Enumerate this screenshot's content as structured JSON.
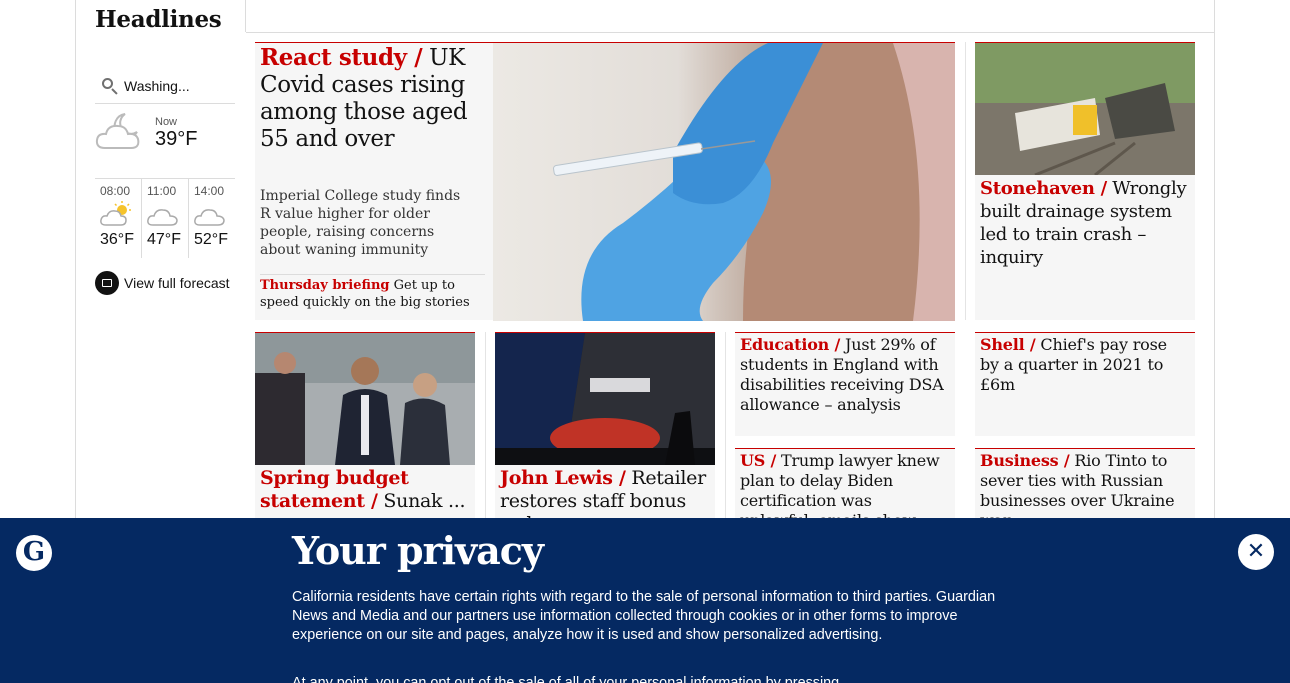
{
  "section": {
    "title": "Headlines"
  },
  "weather": {
    "location": "Washing...",
    "now_label": "Now",
    "now_temp": "39°F",
    "forecast": [
      {
        "time": "08:00",
        "temp": "36°F",
        "icon": "sun-cloud-icon"
      },
      {
        "time": "11:00",
        "temp": "47°F",
        "icon": "cloud-icon"
      },
      {
        "time": "14:00",
        "temp": "52°F",
        "icon": "cloud-icon"
      }
    ],
    "full_forecast": "View full forecast"
  },
  "lead": {
    "kicker": "React study /",
    "headline": " UK Covid cases rising among those aged 55 and over",
    "standfirst": "Imperial College study finds R value higher for older people, raising concerns about waning immunity",
    "briefing_kicker": "Thursday briefing",
    "briefing_text": " Get up to speed quickly on the big stories"
  },
  "right_top": {
    "kicker": "Stonehaven /",
    "headline": " Wrongly built drainage system led to train crash – inquiry"
  },
  "cards": [
    {
      "kicker": "Spring budget statement /",
      "headline": " Sunak ..."
    },
    {
      "kicker": "John Lewis /",
      "headline": " Retailer restores staff bonus as h..."
    }
  ],
  "small": [
    {
      "kicker": "Education /",
      "headline": " Just 29% of students in England with disabilities receiving DSA allowance – analysis"
    },
    {
      "kicker": "Shell /",
      "headline": " Chief's pay rose by a quarter in 2021 to £6m"
    },
    {
      "kicker": "US /",
      "headline": " Trump lawyer knew plan to delay Biden certification was unlawful, emails show"
    },
    {
      "kicker": "Business /",
      "headline": " Rio Tinto to sever ties with Russian businesses over Ukraine war"
    }
  ],
  "privacy": {
    "title": "Your privacy",
    "body": "California residents have certain rights with regard to the sale of personal information to third parties. Guardian News and Media and our partners use information collected through cookies or in other forms to improve experience on our site and pages, analyze how it is used and show personalized advertising.",
    "body2": "At any point, you can opt out of the sale of all of your personal information by pressing",
    "close_label": "✕",
    "logo_letter": "G"
  },
  "colors": {
    "brand_blue": "#052962",
    "news_red": "#c70000",
    "card_bg": "#f6f6f6"
  }
}
